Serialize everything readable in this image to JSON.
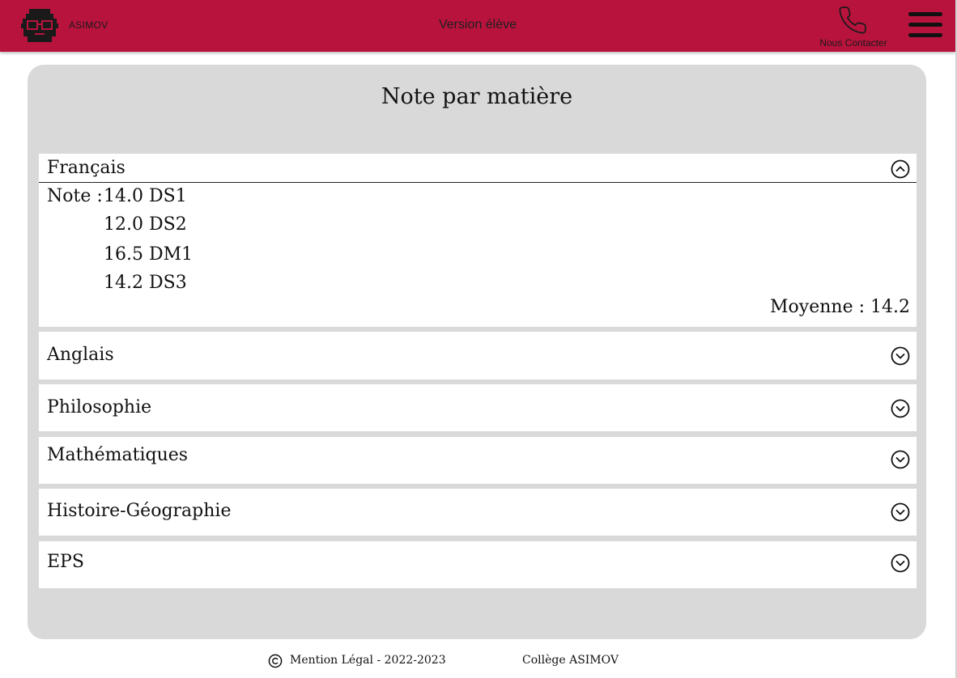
{
  "header": {
    "brand": "ASIMOV",
    "version": "Version élève",
    "contact_label": "Nous Contacter",
    "background": "#b8133d"
  },
  "main": {
    "title": "Note par matière",
    "subjects": [
      {
        "name": "Français",
        "expanded": true,
        "icon": "chevron-up-icon",
        "grade_prefix": "Note :",
        "grades": [
          "14.0 DS1",
          "12.0 DS2",
          "16.5 DM1",
          "14.2 DS3"
        ],
        "average": "Moyenne : 14.2"
      },
      {
        "name": "Anglais",
        "expanded": false,
        "icon": "chevron-down-icon"
      },
      {
        "name": "Philosophie",
        "expanded": false,
        "icon": "chevron-down-icon"
      },
      {
        "name": "Mathématiques",
        "expanded": false,
        "icon": "chevron-down-icon"
      },
      {
        "name": "Histoire-Géographie",
        "expanded": false,
        "icon": "chevron-down-icon"
      },
      {
        "name": "EPS",
        "expanded": false,
        "icon": "chevron-down-icon"
      }
    ]
  },
  "footer": {
    "legal": "Mention Légal - 2022-2023",
    "college": "Collège ASIMOV"
  },
  "colors": {
    "accent": "#b8133d",
    "panel": "#d9d9d9",
    "card": "#ffffff"
  }
}
